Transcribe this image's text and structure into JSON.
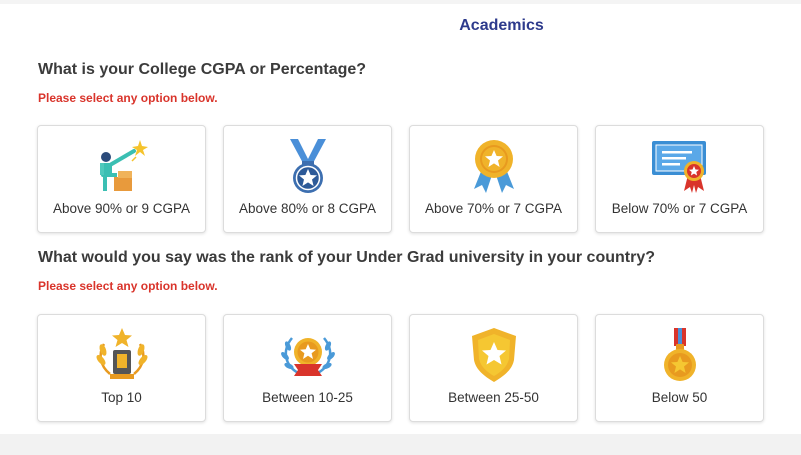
{
  "header": {
    "title": "Academics"
  },
  "cgpa": {
    "question": "What is your College CGPA or Percentage?",
    "hint": "Please select any option below.",
    "options": [
      {
        "label": "Above 90% or 9 CGPA",
        "icon": "person-podium-star-icon"
      },
      {
        "label": "Above 80% or 8 CGPA",
        "icon": "medal-star-icon"
      },
      {
        "label": "Above 70% or 7 CGPA",
        "icon": "award-rosette-icon"
      },
      {
        "label": "Below 70% or 7 CGPA",
        "icon": "certificate-icon"
      }
    ]
  },
  "rank": {
    "question": "What would you say was the rank of your Under Grad university in your country?",
    "hint": "Please select any option below.",
    "options": [
      {
        "label": "Top 10",
        "icon": "trophy-laurel-icon"
      },
      {
        "label": "Between 10-25",
        "icon": "laurel-wreath-star-icon"
      },
      {
        "label": "Between 25-50",
        "icon": "shield-star-icon"
      },
      {
        "label": "Below 50",
        "icon": "gold-medal-icon"
      }
    ]
  },
  "colors": {
    "title": "#2d3a8c",
    "hint": "#d9342b",
    "question": "#3b3b3b"
  }
}
